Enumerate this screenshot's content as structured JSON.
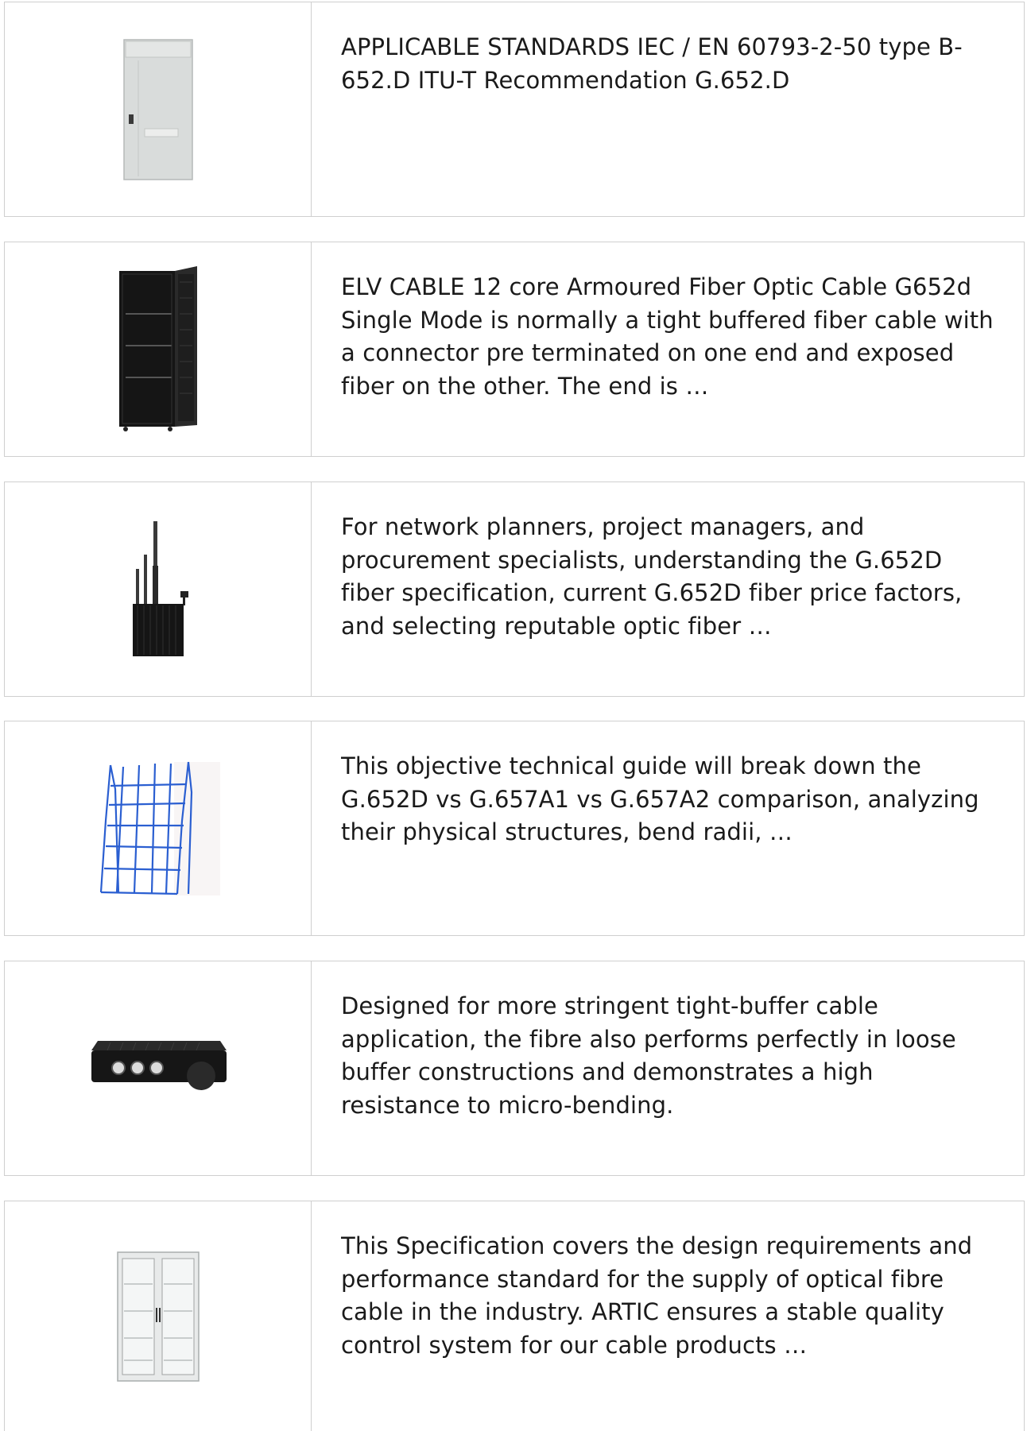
{
  "items": [
    {
      "image": "grey-outdoor-cabinet-image",
      "text": "APPLICABLE STANDARDS IEC / EN 60793-2-50 type B-652.D ITU-T Recommendation G.652.D"
    },
    {
      "image": "black-server-rack-image",
      "text": "ELV CABLE 12 core Armoured Fiber Optic Cable G652d Single Mode is normally a tight buffered fiber cable with a connector pre terminated on one end and exposed fiber on the other. The end is …"
    },
    {
      "image": "antenna-enclosure-image",
      "text": "For network planners, project managers, and procurement specialists, understanding the G.652D fiber specification, current G.652D fiber price factors, and selecting reputable optic fiber …"
    },
    {
      "image": "wire-mesh-cable-tray-image",
      "text": "This objective technical guide will break down the G.652D vs G.657A1 vs G.657A2 comparison, analyzing their physical structures, bend radii, …"
    },
    {
      "image": "black-junction-box-image",
      "text": "Designed for more stringent tight-buffer cable application, the fibre also performs perfectly in loose buffer constructions and demonstrates a high resistance to micro-bending."
    },
    {
      "image": "glass-door-cabinet-image",
      "text": "This Specification covers the design requirements and performance standard for the supply of optical fibre cable in the industry. ARTIC ensures a stable quality control system for our cable products …"
    }
  ]
}
